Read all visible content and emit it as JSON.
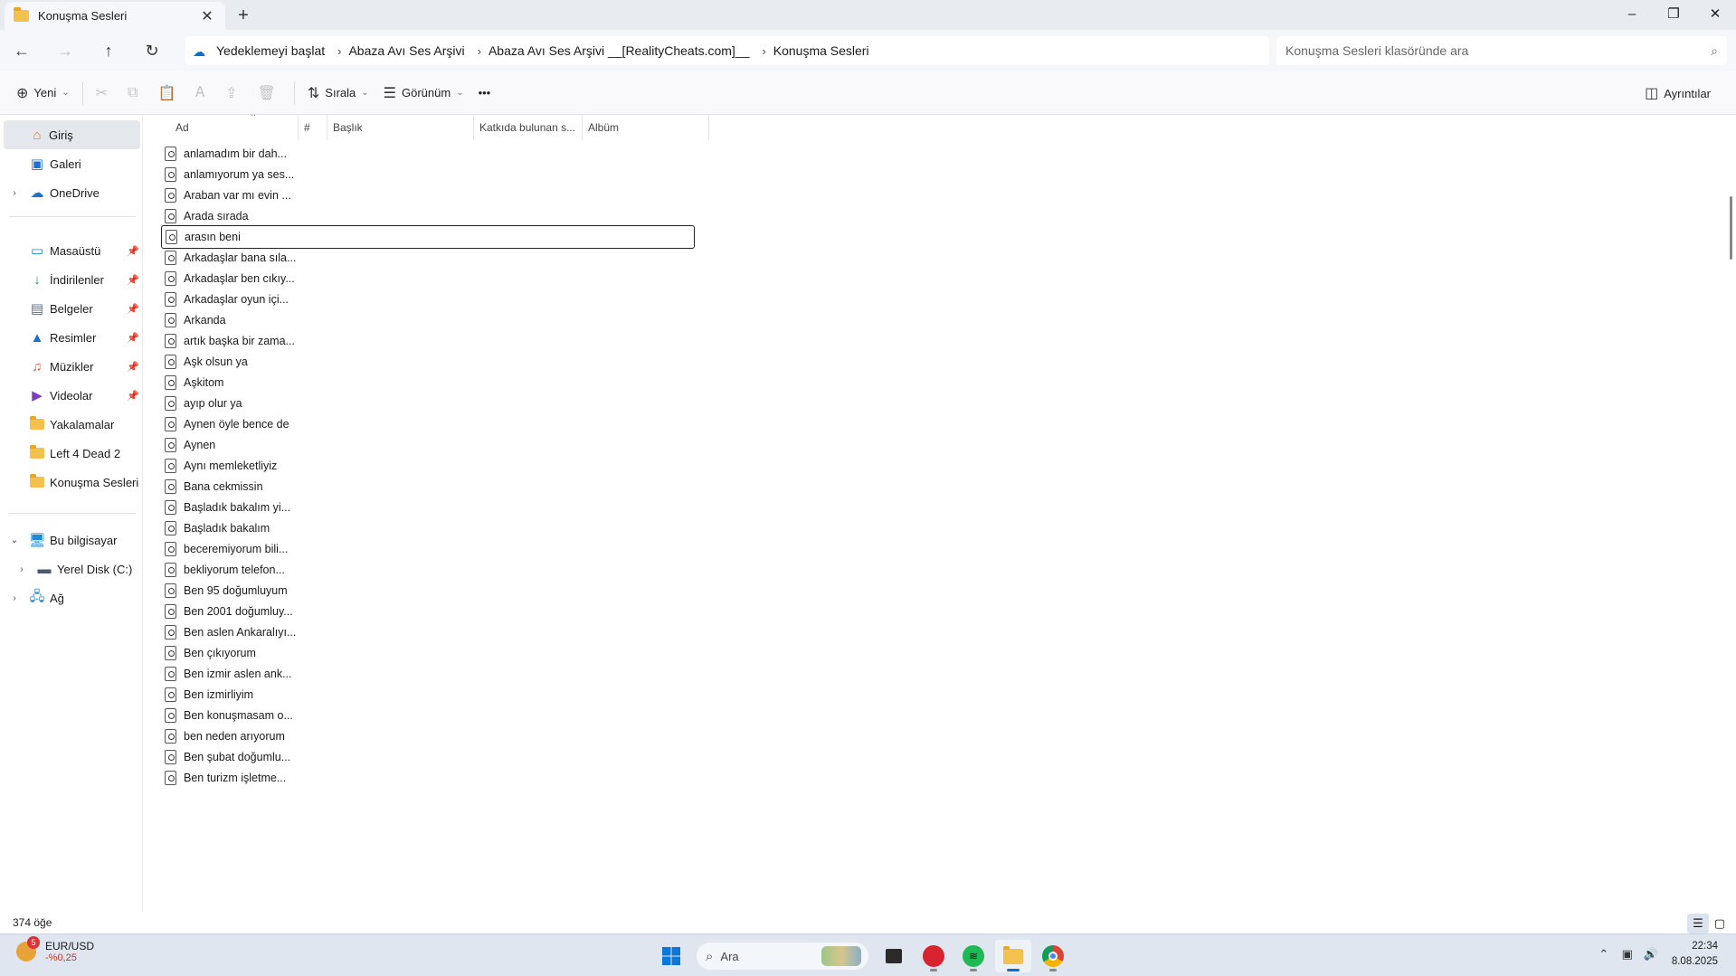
{
  "window": {
    "tab_title": "Konuşma Sesleri",
    "new_tab": "+",
    "controls": {
      "minimize": "–",
      "maximize": "❐",
      "close": "✕"
    }
  },
  "nav": {
    "breadcrumb": [
      "Yedeklemeyi başlat",
      "Abaza Avı Ses Arşivi",
      "Abaza Avı Ses Arşivi __[RealityCheats.com]__",
      "Konuşma Sesleri"
    ],
    "search_placeholder": "Konuşma Sesleri klasöründe ara"
  },
  "toolbar": {
    "new_label": "Yeni",
    "sort_label": "Sırala",
    "view_label": "Görünüm",
    "more_label": "•••",
    "details_label": "Ayrıntılar"
  },
  "sidebar": {
    "home": "Giriş",
    "gallery": "Galeri",
    "onedrive": "OneDrive",
    "quick": [
      {
        "label": "Masaüstü",
        "icon": "desktop-icon"
      },
      {
        "label": "İndirilenler",
        "icon": "download-icon"
      },
      {
        "label": "Belgeler",
        "icon": "documents-icon"
      },
      {
        "label": "Resimler",
        "icon": "pictures-icon"
      },
      {
        "label": "Müzikler",
        "icon": "music-icon"
      },
      {
        "label": "Videolar",
        "icon": "videos-icon"
      },
      {
        "label": "Yakalamalar",
        "icon": "folder-icon"
      },
      {
        "label": "Left 4 Dead 2",
        "icon": "folder-icon"
      },
      {
        "label": "Konuşma Sesleri",
        "icon": "folder-icon"
      }
    ],
    "this_pc": "Bu bilgisayar",
    "local_disk": "Yerel Disk (C:)",
    "network": "Ağ"
  },
  "columns": [
    "Ad",
    "#",
    "Başlık",
    "Katkıda bulunan s...",
    "Albüm"
  ],
  "files": [
    "anlamadım bir dah...",
    "anlamıyorum ya ses...",
    "Araban var mı evin ...",
    "Arada sırada",
    "arasın beni",
    "Arkadaşlar bana sıla...",
    "Arkadaşlar ben cıkıy...",
    "Arkadaşlar oyun içi...",
    "Arkanda",
    "artık başka bir zama...",
    "Aşk olsun ya",
    "Aşkitom",
    "ayıp olur ya",
    "Aynen öyle bence de",
    "Aynen",
    "Aynı memleketliyiz",
    "Bana cekmissin",
    "Başladık bakalım yi...",
    "Başladık bakalım",
    "beceremiyorum bili...",
    "bekliyorum telefon...",
    "Ben 95 doğumluyum",
    "Ben 2001 doğumluy...",
    "Ben aslen Ankaralıyı...",
    "Ben çıkıyorum",
    "Ben izmir aslen ank...",
    "Ben izmirliyim",
    "Ben konuşmasam o...",
    "ben neden arıyorum",
    "Ben şubat doğumlu...",
    "Ben turizm işletme..."
  ],
  "focused_index": 4,
  "status": {
    "item_count": "374 öğe"
  },
  "taskbar": {
    "widget_title": "EUR/USD",
    "widget_value": "-%0,25",
    "widget_badge": "5",
    "search_label": "Ara",
    "time": "22:34",
    "date": "8.08.2025"
  },
  "colors": {
    "accent": "#0a6ed1",
    "folder": "#f2c14e",
    "negative": "#c0392b"
  }
}
